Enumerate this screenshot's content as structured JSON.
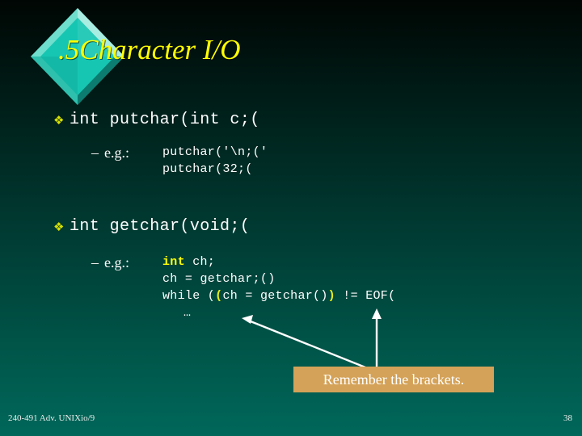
{
  "slide": {
    "title": ".5Character I/O",
    "background_top_color": "#000603",
    "background_bottom_color": "#00675a",
    "accent_yellow": "#ffff00",
    "callout_color": "#d4a258"
  },
  "decor": {
    "diamond_icon": "diamond-decoration",
    "diamond_light": "#7fe3d6",
    "diamond_mid": "#18c9b4",
    "diamond_dark": "#0e8f80"
  },
  "bullets": [
    {
      "marker": "❖",
      "text": "int putchar(int c;(",
      "sub": {
        "dash": "–",
        "label": "e.g.:",
        "code": [
          "putchar('\\n;('",
          "putchar(32;("
        ]
      }
    },
    {
      "marker": "❖",
      "text": "int getchar(void;(",
      "sub": {
        "dash": "–",
        "label": "e.g.:",
        "code_line_1_kw": "int",
        "code_line_1_rest": " ch;",
        "code_line_2": "ch = getchar;()",
        "code_line_3_pre": "while (",
        "code_line_3_paren_open": "(",
        "code_line_3_mid": "ch = getchar()",
        "code_line_3_paren_close": ")",
        "code_line_3_post": " != EOF(",
        "ellipsis": "…"
      }
    }
  ],
  "callout": {
    "text": "Remember the brackets."
  },
  "arrows": {
    "diagonal_arrow": "arrow-to-open-paren",
    "vertical_arrow": "arrow-to-close-paren",
    "color": "#ffffff"
  },
  "footer": {
    "left": "240-491 Adv. UNIXio/9",
    "page": "38"
  }
}
